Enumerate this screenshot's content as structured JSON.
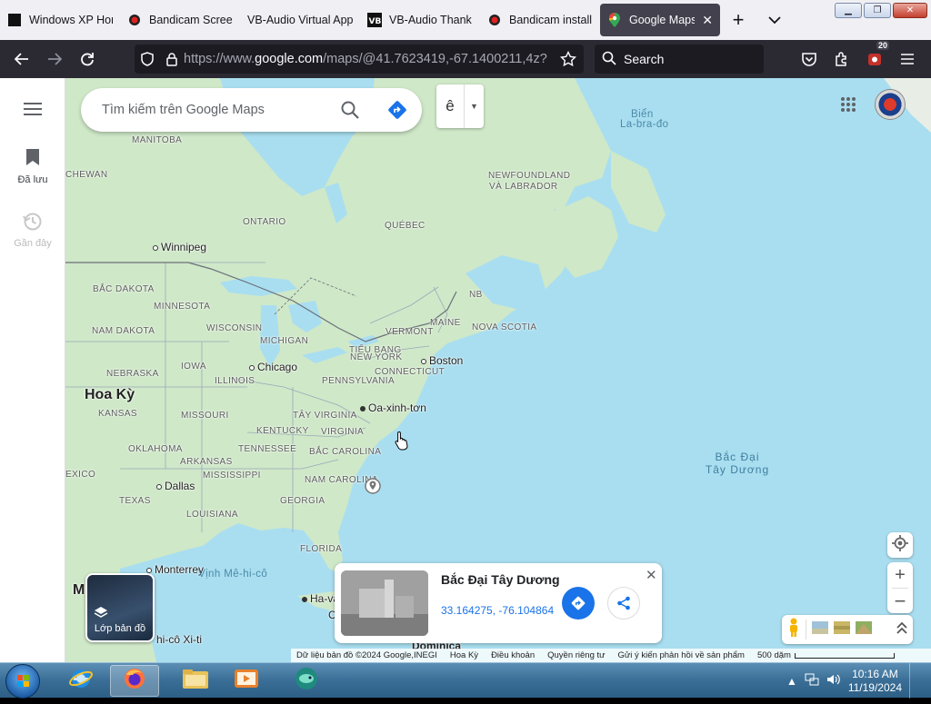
{
  "browser": {
    "tabs": [
      {
        "title": "Windows XP Hor",
        "icon": "windows-favicon-icon",
        "active": false
      },
      {
        "title": "Bandicam Screer",
        "icon": "bandicam-record-icon",
        "active": false
      },
      {
        "title": "VB-Audio Virtual App",
        "icon": "none",
        "active": false
      },
      {
        "title": "VB-Audio Thank",
        "icon": "vb-logo-icon",
        "active": false
      },
      {
        "title": "Bandicam install",
        "icon": "bandicam-record-icon",
        "active": false
      },
      {
        "title": "Google Maps",
        "icon": "google-maps-pin-icon",
        "active": true
      }
    ],
    "url_main": "https://www.google.com",
    "url_rest": "/maps/@41.7623419,-67.1400211,4z?er",
    "search_placeholder": "Search",
    "extension_badge": "20"
  },
  "sidebar": {
    "items": [
      {
        "label": "Đã lưu",
        "icon": "bookmark-icon"
      },
      {
        "label": "Gần đây",
        "icon": "history-icon"
      }
    ]
  },
  "search": {
    "placeholder": "Tìm kiếm trên Google Maps",
    "language_button": "ê"
  },
  "map": {
    "labels": {
      "manitoba": "MANITOBA",
      "chewan": "CHEWAN",
      "ontario": "ONTARIO",
      "quebec": "QUÉBEC",
      "newfoundland1": "NEWFOUNDLAND",
      "newfoundland2": "VÀ LABRADOR",
      "labrador_sea1": "Biển",
      "labrador_sea2": "La-bra-đo",
      "winnipeg": "Winnipeg",
      "north_dakota": "BẮC DAKOTA",
      "minnesota": "MINNESOTA",
      "south_dakota": "NAM DAKOTA",
      "wisconsin": "WISCONSIN",
      "michigan": "MICHIGAN",
      "nebraska": "NEBRASKA",
      "iowa": "IOWA",
      "illinois": "ILLINOIS",
      "chicago": "Chicago",
      "usa": "Hoa Kỳ",
      "kansas": "KANSAS",
      "missouri": "MISSOURI",
      "kentucky": "KENTUCKY",
      "west_virginia": "TÂY VIRGINIA",
      "virginia": "VIRGINIA",
      "oklahoma": "OKLAHOMA",
      "tennessee": "TENNESSEE",
      "north_carolina": "BẮC CAROLINA",
      "arkansas": "ARKANSAS",
      "south_carolina": "NAM CAROLINA",
      "mississippi": "MISSISSIPPI",
      "dallas": "Dallas",
      "georgia": "GEORGIA",
      "texas": "TEXAS",
      "louisiana": "LOUISIANA",
      "florida": "FLORIDA",
      "mexico_partial": "EXICO",
      "monterrey": "Monterrey",
      "gulf_mexico": "Vịnh Mê-hi-cô",
      "havana": "Ha-va",
      "mexico_city": "hi-cô Xi-ti",
      "dominica": "Dominica",
      "pennsylvania": "PENNSYLVANIA",
      "new_york1": "TIỂU BANG",
      "new_york2": "NEW YORK",
      "connecticut": "CONNECTICUT",
      "vermont": "VERMONT",
      "maine": "MAINE",
      "nb": "NB",
      "nova_scotia": "NOVA SCOTIA",
      "boston": "Boston",
      "washington": "Oa-xinh-tơn",
      "atlantic1": "Bắc Đại",
      "atlantic2": "Tây Dương",
      "m_partial": "M",
      "c_partial": "C"
    }
  },
  "layers_button": "Lớp bản đồ",
  "place_card": {
    "title": "Bắc Đại Tây Dương",
    "coords": "33.164275, -76.104864"
  },
  "footer": {
    "data": "Dữ liệu bản đồ ©2024 Google,INEGI",
    "region": "Hoa Kỳ",
    "terms": "Điều khoản",
    "privacy": "Quyền riêng tư",
    "feedback": "Gửi ý kiến phản hồi về sản phẩm",
    "scale": "500 dặm"
  },
  "taskbar": {
    "time": "10:16 AM",
    "date": "11/19/2024"
  },
  "colors": {
    "water": "#a9def0",
    "land": "#cfe8c8",
    "accent": "#1a73e8"
  }
}
